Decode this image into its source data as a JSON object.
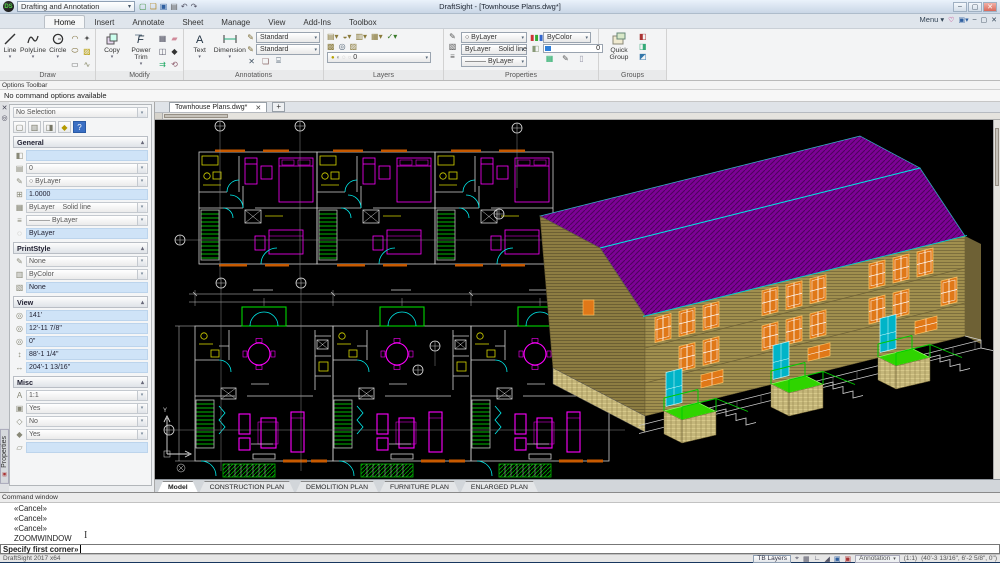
{
  "title_bar": {
    "workspace": "Drafting and Annotation",
    "title": "DraftSight - [Townhouse Plans.dwg*]"
  },
  "menu": {
    "tabs": [
      "Home",
      "Insert",
      "Annotate",
      "Sheet",
      "Manage",
      "View",
      "Add-Ins",
      "Toolbox"
    ],
    "active_tab": "Home",
    "menu_label": "Menu"
  },
  "ribbon": {
    "draw": {
      "label": "Draw",
      "line": "Line",
      "polyline": "PolyLine",
      "circle": "Circle"
    },
    "modify": {
      "label": "Modify",
      "copy": "Copy",
      "power_trim": "Power Trim"
    },
    "annotations": {
      "label": "Annotations",
      "text": "Text",
      "dimension": "Dimension",
      "text_style": "Standard",
      "dim_style": "Standard"
    },
    "layers": {
      "label": "Layers",
      "active_layer": "0"
    },
    "properties": {
      "label": "Properties",
      "line_color": "○ ByLayer",
      "line_style": "ByLayer    Solid line",
      "line_weight": "——— ByLayer",
      "hatch_color": "ByColor",
      "transparency": "0"
    },
    "groups": {
      "label": "Groups",
      "quick_group": "Quick Group"
    }
  },
  "options_bar": {
    "title": "Options Toolbar",
    "message": "No command options available"
  },
  "palette": {
    "selection": "No Selection",
    "side_tab": "Properties",
    "general": {
      "title": "General",
      "rows": [
        {
          "glyph": "◧",
          "value": ""
        },
        {
          "glyph": "▤",
          "value": "0"
        },
        {
          "glyph": "✎",
          "value": "○ ByLayer"
        },
        {
          "glyph": "⊞",
          "value": "1.0000"
        },
        {
          "glyph": "▦",
          "value": "ByLayer    Solid line"
        },
        {
          "glyph": "≡",
          "value": "——— ByLayer"
        },
        {
          "glyph": "◌",
          "value": "ByLayer"
        }
      ]
    },
    "printstyle": {
      "title": "PrintStyle",
      "rows": [
        {
          "glyph": "✎",
          "value": "None"
        },
        {
          "glyph": "▥",
          "value": "ByColor"
        },
        {
          "glyph": "▧",
          "value": "None"
        }
      ]
    },
    "view": {
      "title": "View",
      "rows": [
        {
          "glyph": "◎",
          "value": "141'"
        },
        {
          "glyph": "◎",
          "value": "12'-11 7/8\""
        },
        {
          "glyph": "◎",
          "value": "0\""
        },
        {
          "glyph": "↕",
          "value": "88'-1 1/4\""
        },
        {
          "glyph": "↔",
          "value": "204'-1 13/16\""
        }
      ]
    },
    "misc": {
      "title": "Misc",
      "rows": [
        {
          "glyph": "A",
          "value": "1:1"
        },
        {
          "glyph": "▣",
          "value": "Yes"
        },
        {
          "glyph": "◇",
          "value": "No"
        },
        {
          "glyph": "◆",
          "value": "Yes"
        },
        {
          "glyph": "▱",
          "value": ""
        }
      ]
    }
  },
  "document_tab": {
    "name": "Townhouse Plans.dwg*"
  },
  "sheet_tabs": {
    "items": [
      "Model",
      "CONSTRUCTION PLAN",
      "DEMOLITION PLAN",
      "FURNITURE PLAN",
      "ENLARGED PLAN"
    ],
    "active": "Model"
  },
  "command_window": {
    "title": "Command window",
    "lines": [
      "«Cancel»",
      "«Cancel»",
      "«Cancel»",
      "ZOOMWINDOW"
    ],
    "prompt": "Specify first corner»"
  },
  "status_bar": {
    "version": "DraftSight 2017 x64",
    "tb_layers": "TB Layers",
    "annotation_scale": "Annotation",
    "ratio": "(1:1)",
    "coords": "(40'-3 13/16\", 6'-2 5/8\", 0\")"
  },
  "colors": {
    "cad_wall": "#d0d0d0",
    "cad_magenta": "#ff00ff",
    "cad_cyan": "#00eded",
    "cad_yellow": "#d6d600",
    "cad_green": "#00d800",
    "cad_orange": "#c85a00",
    "roof_purple": "#7d0296",
    "selection_blue": "#cfe3f7"
  }
}
